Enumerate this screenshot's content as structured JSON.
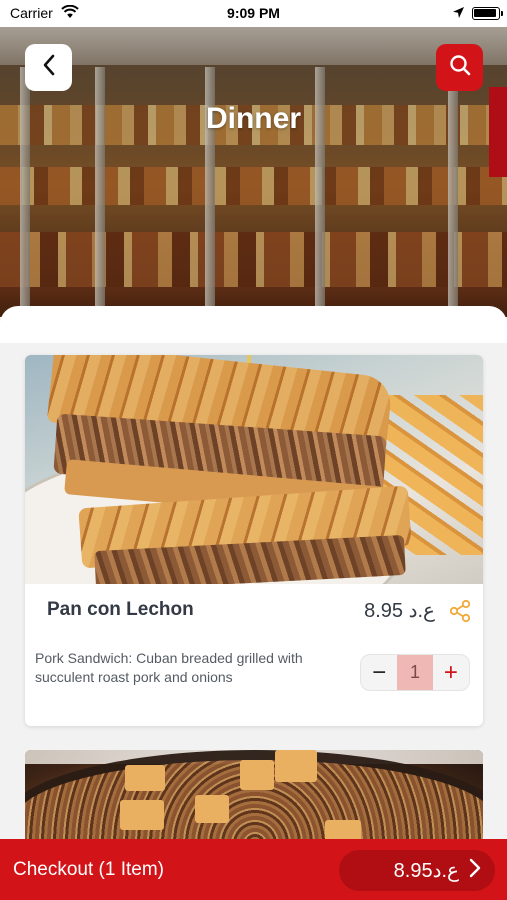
{
  "status_bar": {
    "carrier": "Carrier",
    "time": "9:09 PM",
    "icons": [
      "wifi-icon",
      "location-arrow-icon",
      "battery-icon"
    ]
  },
  "header": {
    "title": "Dinner",
    "back_icon": "chevron-left-icon",
    "search_icon": "search-icon",
    "accent_color": "#d21418"
  },
  "menu_items": [
    {
      "name": "Pan con Lechon",
      "price": "8.95 ع.د",
      "description": "Pork Sandwich: Cuban breaded grilled with succulent roast pork and onions",
      "quantity": "1",
      "stepper": {
        "minus": "−",
        "plus": "+"
      },
      "share_icon": "share-icon"
    }
  ],
  "checkout": {
    "label": "Checkout (1 Item)",
    "total": "8.95ع.د",
    "icon": "chevron-right-icon"
  }
}
